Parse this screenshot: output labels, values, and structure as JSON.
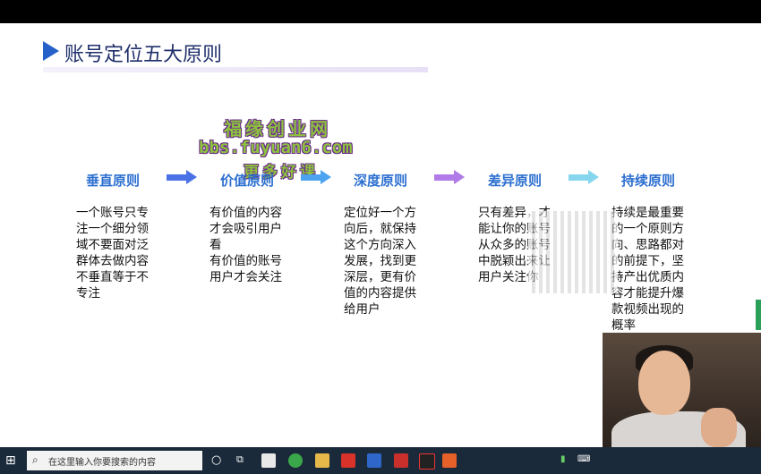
{
  "slide": {
    "title": "账号定位五大原则",
    "watermark": {
      "line1": "福缘创业网",
      "line2": "bbs.fuyuan6.com",
      "line3": "更多好课"
    },
    "columns": [
      {
        "title": "垂直原则",
        "body": "一个账号只专注一个细分领域不要面对泛群体去做内容不垂直等于不专注"
      },
      {
        "title": "价值原则",
        "body": "有价值的内容才会吸引用户看\n有价值的账号用户才会关注"
      },
      {
        "title": "深度原则",
        "body": "定位好一个方向后，就保持这个方向深入发展，找到更深层，更有价值的内容提供给用户"
      },
      {
        "title": "差异原则",
        "body": "只有差异，才能让你的账号从众多的账号中脱颖出来让用户关注你"
      },
      {
        "title": "持续原则",
        "body": "持续是最重要的一个原则方向、思路都对的前提下，坚持产出优质内容才能提升爆款视频出现的概率"
      }
    ],
    "arrow_colors": [
      "#4a72e6",
      "#4ea3f0",
      "#b07ae8",
      "#86d7ee"
    ],
    "title_color": "#2c6fd0"
  },
  "taskbar": {
    "search_placeholder": "在这里输入你要搜索的内容",
    "start_icon": "windows-icon"
  }
}
